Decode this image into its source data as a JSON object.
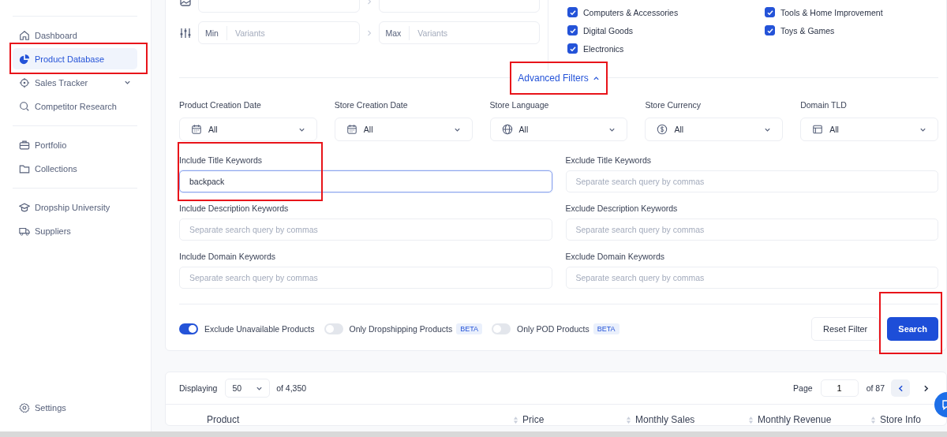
{
  "sidebar": {
    "groups": [
      [
        {
          "label": "Dashboard",
          "kind": "home",
          "selected": false,
          "has_submenu": false,
          "highlighted": false
        },
        {
          "label": "Product Database",
          "kind": "pie",
          "selected": true,
          "has_submenu": false,
          "highlighted": true
        },
        {
          "label": "Sales Tracker",
          "kind": "target",
          "selected": false,
          "has_submenu": true,
          "highlighted": false
        },
        {
          "label": "Competitor Research",
          "kind": "search",
          "selected": false,
          "has_submenu": false,
          "highlighted": false
        }
      ],
      [
        {
          "label": "Portfolio",
          "kind": "briefcase",
          "selected": false,
          "has_submenu": false,
          "highlighted": false
        },
        {
          "label": "Collections",
          "kind": "folder",
          "selected": false,
          "has_submenu": false,
          "highlighted": false
        }
      ],
      [
        {
          "label": "Dropship University",
          "kind": "cap",
          "selected": false,
          "has_submenu": false,
          "highlighted": false
        },
        {
          "label": "Suppliers",
          "kind": "truck",
          "selected": false,
          "has_submenu": false,
          "highlighted": false
        }
      ]
    ],
    "settings": {
      "label": "Settings"
    }
  },
  "filters": {
    "ranges": [
      {
        "kind": "images"
      },
      {
        "kind": "variants",
        "min_label": "Min",
        "min_placeholder": "Variants",
        "max_label": "Max",
        "max_placeholder": "Variants"
      }
    ],
    "categories": [
      {
        "label": "Computers & Accessories",
        "checked": true
      },
      {
        "label": "Digital Goods",
        "checked": true
      },
      {
        "label": "Electronics",
        "checked": true
      },
      {
        "label": "Tools & Home Improvement",
        "checked": true
      },
      {
        "label": "Toys & Games",
        "checked": true
      }
    ],
    "advanced": {
      "label": "Advanced Filters",
      "expanded": true,
      "highlighted": true
    },
    "selects": [
      {
        "label": "Product Creation Date",
        "kind": "calendar",
        "value": "All"
      },
      {
        "label": "Store Creation Date",
        "kind": "calendar",
        "value": "All"
      },
      {
        "label": "Store Language",
        "kind": "globe",
        "value": "All"
      },
      {
        "label": "Store Currency",
        "kind": "dollar",
        "value": "All"
      },
      {
        "label": "Domain TLD",
        "kind": "window",
        "value": "All"
      }
    ],
    "keywords": [
      {
        "label": "Include Title Keywords",
        "value": "backpack",
        "focused": true,
        "highlighted": true
      },
      {
        "label": "Exclude Title Keywords",
        "placeholder": "Separate search query by commas",
        "focused": false,
        "highlighted": false
      },
      {
        "label": "Include Description Keywords",
        "placeholder": "Separate search query by commas",
        "focused": false,
        "highlighted": false
      },
      {
        "label": "Exclude Description Keywords",
        "placeholder": "Separate search query by commas",
        "focused": false,
        "highlighted": false
      },
      {
        "label": "Include Domain Keywords",
        "placeholder": "Separate search query by commas",
        "focused": false,
        "highlighted": false
      },
      {
        "label": "Exclude Domain Keywords",
        "placeholder": "Separate search query by commas",
        "focused": false,
        "highlighted": false
      }
    ],
    "toggles": [
      {
        "label": "Exclude Unavailable Products",
        "on": true
      },
      {
        "label": "Only Dropshipping Products",
        "on": false,
        "badge": "BETA"
      },
      {
        "label": "Only POD Products",
        "on": false,
        "badge": "BETA"
      }
    ],
    "reset_button": {
      "label": "Reset Filter"
    },
    "search_button": {
      "label": "Search",
      "highlighted": true
    }
  },
  "results": {
    "displaying_label": "Displaying",
    "per_page": "50",
    "total": "of 4,350",
    "page_label": "Page",
    "page": "1",
    "page_total": "of 87",
    "columns": [
      {
        "label": "Product",
        "sortable": false
      },
      {
        "label": "Price",
        "sortable": true
      },
      {
        "label": "Monthly Sales",
        "sortable": true
      },
      {
        "label": "Monthly Revenue",
        "sortable": true
      },
      {
        "label": "Store Info",
        "sortable": true
      }
    ]
  }
}
